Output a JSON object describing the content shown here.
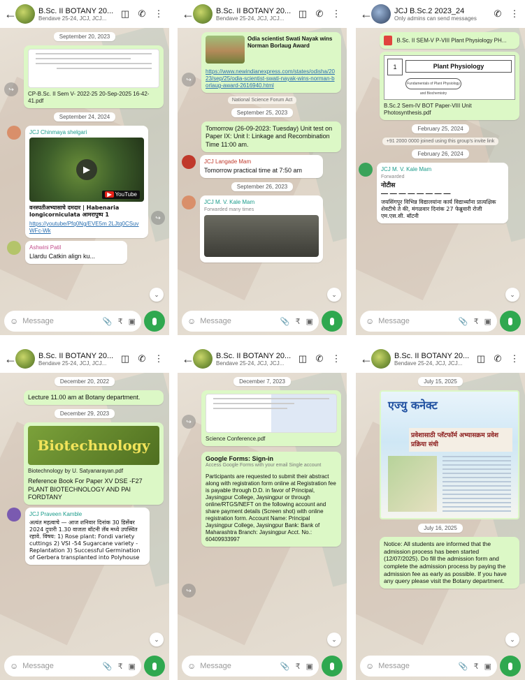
{
  "panels": [
    {
      "title": "B.Sc. II BOTANY 20...",
      "subtitle": "Bendave 25-24, JCJ, JCJ...",
      "date1": "September 20, 2023",
      "doc_name": "CP-B.Sc. II Sem V- 2022-25 20-Sep-2025 16-42-41.pdf",
      "date2": "September 24, 2024",
      "sender": "JCJ Chinmaya shelgari",
      "yt_label": "YouTube",
      "video_title": "वनस्पतीअभ्यासाचे दमदार | Habenaria longicorniculata आमरापुष्प 1",
      "video_link": "https://youtube/Pfq0Ng/EVE5m 2LJtq0CSuvWFc-Wk",
      "sender2": "Ashwini Patil",
      "partial": "Llardu Catkin align ku..."
    },
    {
      "title": "B.Sc. II BOTANY 20...",
      "subtitle": "Bendave 25-24, JCJ, JCJ...",
      "news_title": "Odia scientist Swati Nayak wins Norman Borlaug Award",
      "news_link": "https://www.newindianexpress.com/states/odisha/2023/sep/25/odia-scientist-swati-nayak-wins-norman-borlaug-award-2616940.html",
      "sys": "National Science Forum Act",
      "date1": "September 25, 2023",
      "notice": "Tomorrow (26-09-2023: Tuesday) Unit test on Paper IX: Unit I: Linkage and Recombination Time 11:00 am.",
      "sender": "JCJ Langade Mam",
      "practical": "Tomorrow practical time at 7:50 am",
      "date2": "September 26, 2023",
      "sender2": "JCJ M. V. Kale Mam",
      "forwarded": "Forwarded many times"
    },
    {
      "title": "JCJ B.Sc.2 2023_24",
      "subtitle": "Only admins can send messages",
      "doc1": "B.Sc. II SEM-V P-VIII Plant Physiology PH...",
      "pp_title": "Plant Physiology",
      "pp_num": "1",
      "pp_oval": "Fundamentals of Plant Physiology and Biochemistry",
      "doc2": "B.Sc.2 Sem-IV BOT Paper-VIII Unit Photosynthesis.pdf",
      "date1": "February 25, 2024",
      "sys": "+91 2000 0000 joined using this group's invite link",
      "date2": "February 26, 2024",
      "sender": "JCJ M. V. Kale Mam",
      "forwarded": "Forwarded",
      "notice_head": "नोटीस",
      "dashes": "— — — — — — — —",
      "notice_body": "जयसिंगपूर विभिन्न विद्यालयांना कार्य विद्यार्थ्यांना प्रात्यक्षिक शेवटीचे ते की, मंगळवार दिनांक 27 फेब्रुवारी रोजी एम.एस.सी. बॉटनी"
    },
    {
      "title": "B.Sc. II BOTANY 20...",
      "subtitle": "Bendave 25-24, JCJ, JCJ...",
      "date1": "December 20, 2022",
      "lecture": "Lecture 11.00 am at Botany department.",
      "date2": "December 29, 2023",
      "book_cover": "Biotechnology",
      "book_file": "Biotechnology by U. Satyanarayan.pdf",
      "book_note": "Reference Book For Paper XV DSE -F27 PLANT BIOTECHNOLOGY AND PAI FORDTANY",
      "sender": "JCJ Praveen Kamble",
      "hindi_body": "अत्यंत महत्वाचे — आज शनिवार दिनांक 30 डिसेंबर 2024 दुपारी 1.30 वाजता बॉटनी लॅब मध्ये उपस्थित रहावे. विषय: 1) Rose plant: Fondi variety cuttings 2) VSI -54 Sugarcane variety - Replantation 3) Successful Germination of Gerbera transplanted into Polyhouse"
    },
    {
      "title": "B.Sc. II BOTANY 20...",
      "subtitle": "Bendave 25-24, JCJ, JCJ...",
      "date1": "December 7, 2023",
      "doc": "Science Conference.pdf",
      "form_title": "Google Forms: Sign-in",
      "form_desc": "Access Google Forms with your email Single account",
      "body": "Participants are requested to submit their abstract along with registration form online at Registration fee is payable through D.D. in favor of Principal, Jaysingpur College, Jaysingpur or through online/RTGS/NEFT on the following account and share payment details (Screen shot) with online registration form. Account Name: Principal Jaysingpur College, Jaysingpur Bank: Bank of Maharashtra Branch: Jaysingpur Acct. No.: 60409933997"
    },
    {
      "title": "B.Sc. II BOTANY 20...",
      "subtitle": "Bendave 25-24, JCJ, JCJ...",
      "date1": "July 15, 2025",
      "poster_head": "एज्यु कनेक्ट",
      "poster_sub": "प्रवेशासाठी प्लॅटफॉर्म अभ्यासक्रम प्रवेश प्रक्रिया संधी",
      "date2": "July 16, 2025",
      "notice": "Notice: All students are informed that the admission process has been started (12/07/2025). Do fill the admission form and complete the admission process by paying the admission fee as early as possible. If you have any query please visit the Botany department."
    }
  ],
  "input_placeholder": "Message",
  "back_glyph": "←",
  "play_glyph": "▶",
  "down_glyph": "⌄",
  "fwd_glyph": "↪",
  "icons": [
    "back-arrow-icon",
    "video-call-icon",
    "phone-icon",
    "more-vert-icon",
    "emoji-icon",
    "attach-icon",
    "payment-icon",
    "camera-icon",
    "mic-icon"
  ]
}
